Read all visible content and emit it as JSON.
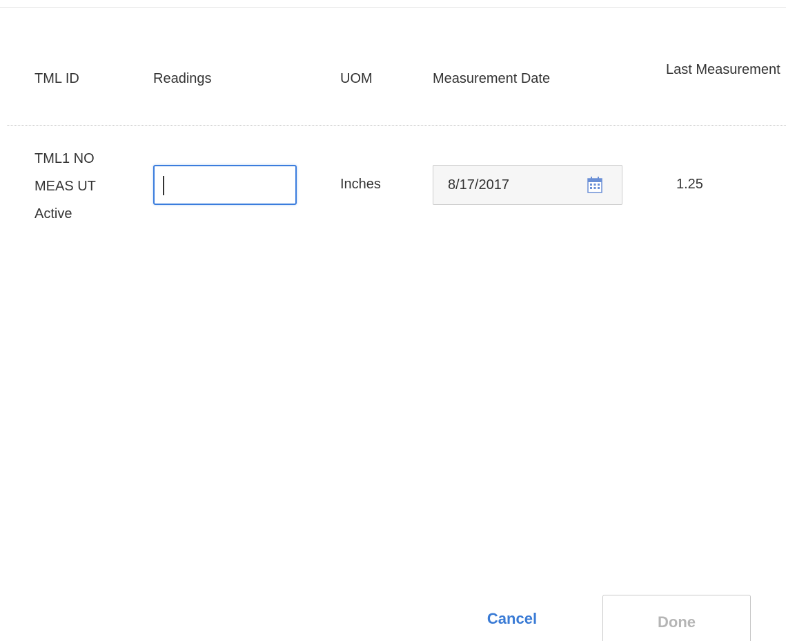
{
  "table": {
    "columns": {
      "tml_id": "TML ID",
      "readings": "Readings",
      "uom": "UOM",
      "measurement_date": "Measurement Date",
      "last_measurement": "Last Measurement"
    },
    "rows": [
      {
        "tml_id": "TML1 NO MEAS UT Active",
        "readings_value": "",
        "uom": "Inches",
        "measurement_date": "8/17/2017",
        "last_measurement": "1.25"
      }
    ]
  },
  "icons": {
    "calendar": "calendar-icon"
  },
  "colors": {
    "focus_border": "#3b7ddd",
    "link_blue": "#3a7bd5",
    "disabled_text": "#b5b5b5"
  },
  "footer": {
    "cancel_label": "Cancel",
    "done_label": "Done"
  }
}
